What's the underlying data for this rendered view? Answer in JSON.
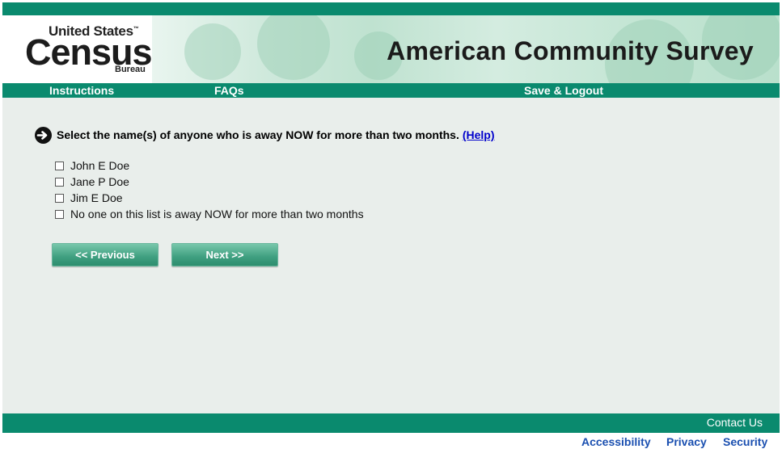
{
  "header": {
    "logo_line1": "United States",
    "logo_tm": "™",
    "logo_line2": "Census",
    "logo_line3": "Bureau",
    "title": "American Community Survey"
  },
  "nav": {
    "instructions": "Instructions",
    "faqs": "FAQs",
    "save_logout": "Save & Logout"
  },
  "question": {
    "text": "Select the name(s) of anyone who is away NOW for more than two months.",
    "help_label": "(Help)"
  },
  "options": [
    {
      "label": "John E Doe",
      "checked": false
    },
    {
      "label": "Jane P Doe",
      "checked": false
    },
    {
      "label": "Jim E Doe",
      "checked": false
    },
    {
      "label": "No one on this list is away NOW for more than two months",
      "checked": false
    }
  ],
  "buttons": {
    "previous": "<<   Previous",
    "next": "Next   >>"
  },
  "footer": {
    "contact": "Contact Us",
    "accessibility": "Accessibility",
    "privacy": "Privacy",
    "security": "Security"
  },
  "colors": {
    "brand_green": "#0a8a6e",
    "link_blue": "#0000cc",
    "footer_link_blue": "#1a4fb0",
    "page_background": "#e9eeeb"
  }
}
